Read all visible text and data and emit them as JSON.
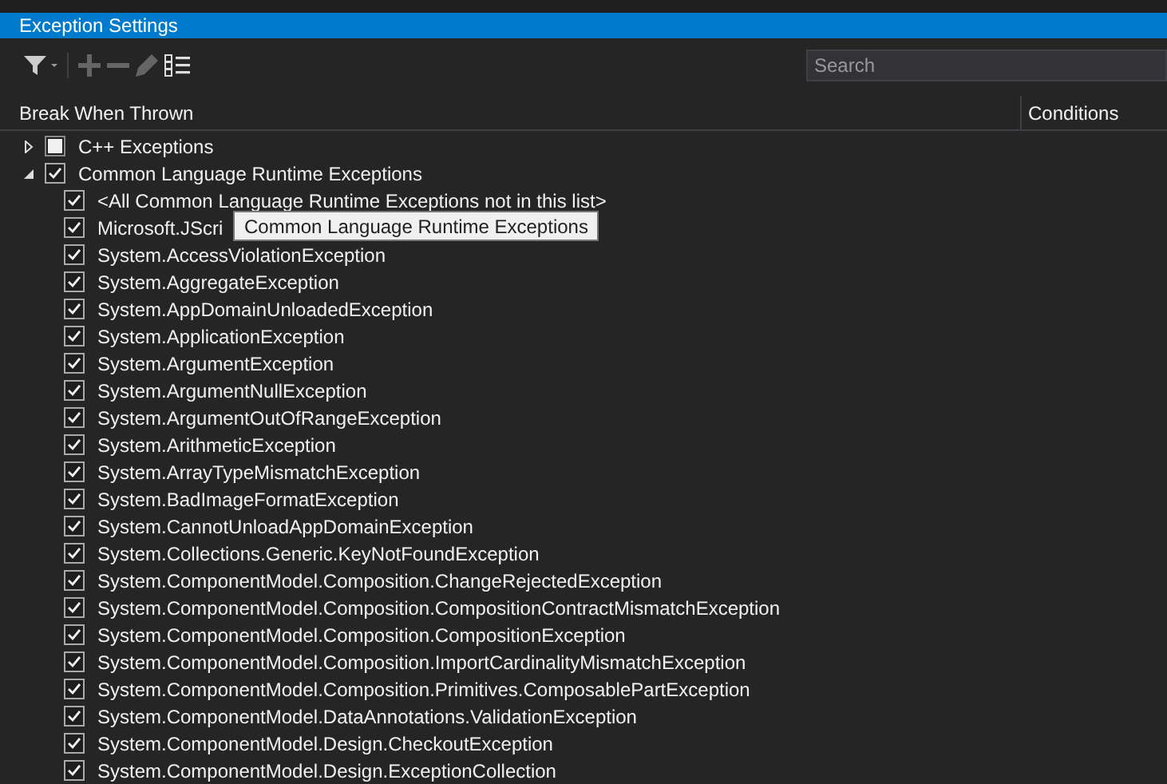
{
  "window": {
    "title": "Exception Settings"
  },
  "toolbar": {
    "search": {
      "placeholder": "Search"
    }
  },
  "columns": [
    "Break When Thrown",
    "Conditions"
  ],
  "tree": [
    {
      "label": "C++ Exceptions",
      "expanded": false,
      "checked": false,
      "indeterminate": true
    },
    {
      "label": "Common Language Runtime Exceptions",
      "expanded": true,
      "checked": true,
      "indeterminate": false,
      "children": [
        {
          "label": "<All Common Language Runtime Exceptions not in this list>",
          "checked": true
        },
        {
          "label": "Microsoft.JScri",
          "checked": true
        },
        {
          "label": "System.AccessViolationException",
          "checked": true
        },
        {
          "label": "System.AggregateException",
          "checked": true
        },
        {
          "label": "System.AppDomainUnloadedException",
          "checked": true
        },
        {
          "label": "System.ApplicationException",
          "checked": true
        },
        {
          "label": "System.ArgumentException",
          "checked": true
        },
        {
          "label": "System.ArgumentNullException",
          "checked": true
        },
        {
          "label": "System.ArgumentOutOfRangeException",
          "checked": true
        },
        {
          "label": "System.ArithmeticException",
          "checked": true
        },
        {
          "label": "System.ArrayTypeMismatchException",
          "checked": true
        },
        {
          "label": "System.BadImageFormatException",
          "checked": true
        },
        {
          "label": "System.CannotUnloadAppDomainException",
          "checked": true
        },
        {
          "label": "System.Collections.Generic.KeyNotFoundException",
          "checked": true
        },
        {
          "label": "System.ComponentModel.Composition.ChangeRejectedException",
          "checked": true
        },
        {
          "label": "System.ComponentModel.Composition.CompositionContractMismatchException",
          "checked": true
        },
        {
          "label": "System.ComponentModel.Composition.CompositionException",
          "checked": true
        },
        {
          "label": "System.ComponentModel.Composition.ImportCardinalityMismatchException",
          "checked": true
        },
        {
          "label": "System.ComponentModel.Composition.Primitives.ComposablePartException",
          "checked": true
        },
        {
          "label": "System.ComponentModel.DataAnnotations.ValidationException",
          "checked": true
        },
        {
          "label": "System.ComponentModel.Design.CheckoutException",
          "checked": true
        },
        {
          "label": "System.ComponentModel.Design.ExceptionCollection",
          "checked": true
        }
      ]
    }
  ],
  "tooltip": "Common Language Runtime Exceptions"
}
